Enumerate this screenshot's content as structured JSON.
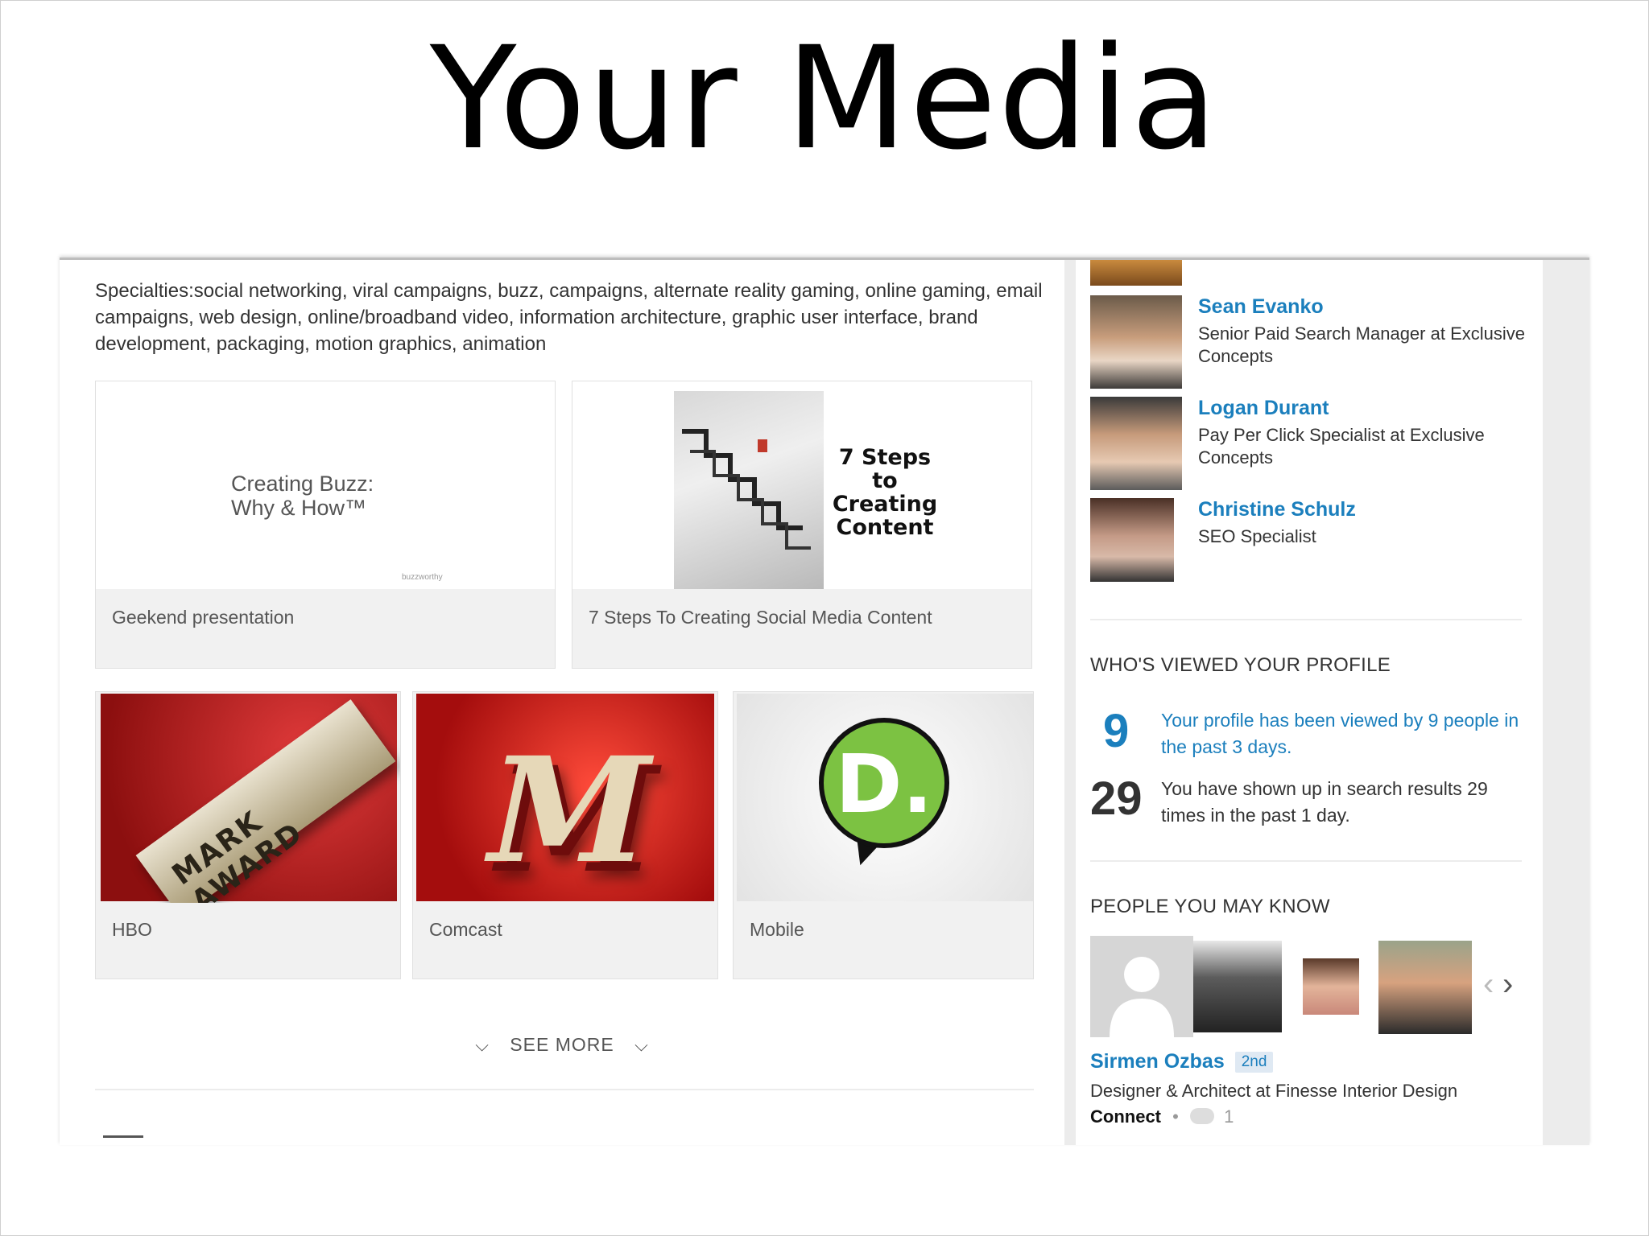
{
  "slide": {
    "title": "Your Media"
  },
  "summary": {
    "specialties": "Specialties:social networking, viral campaigns, buzz, campaigns, alternate reality gaming, online gaming, email campaigns, web design, online/broadband video, information architecture, graphic user interface, brand development, packaging, motion graphics, animation"
  },
  "media": [
    {
      "caption": "Geekend presentation",
      "thumb_title": "Creating Buzz:",
      "thumb_subtitle": "Why & How™",
      "thumb_small": "buzzworthy"
    },
    {
      "caption": "7 Steps To Creating Social Media Content",
      "thumb_text": "7 Steps to Creating Content"
    },
    {
      "caption": "HBO",
      "thumb_text": "MARK AWARD"
    },
    {
      "caption": "Comcast",
      "thumb_text": "M"
    },
    {
      "caption": "Mobile",
      "thumb_text": "D."
    }
  ],
  "see_more": {
    "label": "SEE MORE",
    "icon": "chevron-down-icon"
  },
  "connections": [
    {
      "name": "Sean Evanko",
      "role": "Senior Paid Search Manager at Exclusive Concepts"
    },
    {
      "name": "Logan Durant",
      "role": "Pay Per Click Specialist at Exclusive Concepts"
    },
    {
      "name": "Christine Schulz",
      "role": "SEO Specialist"
    }
  ],
  "profile_views": {
    "heading": "WHO'S VIEWED YOUR PROFILE",
    "views_count": "9",
    "views_text": "Your profile has been viewed by 9 people in the past 3 days.",
    "search_count": "29",
    "search_text": "You have shown up in search results 29 times in the past 1 day."
  },
  "pymk": {
    "heading": "PEOPLE YOU MAY KNOW",
    "name": "Sirmen Ozbas",
    "degree": "2nd",
    "role": "Designer & Architect at Finesse Interior Design",
    "connect_label": "Connect",
    "shared_count": "1"
  },
  "colors": {
    "link": "#1b7fbd",
    "badge_bg": "#dfe9f3",
    "divider": "#ececec"
  }
}
